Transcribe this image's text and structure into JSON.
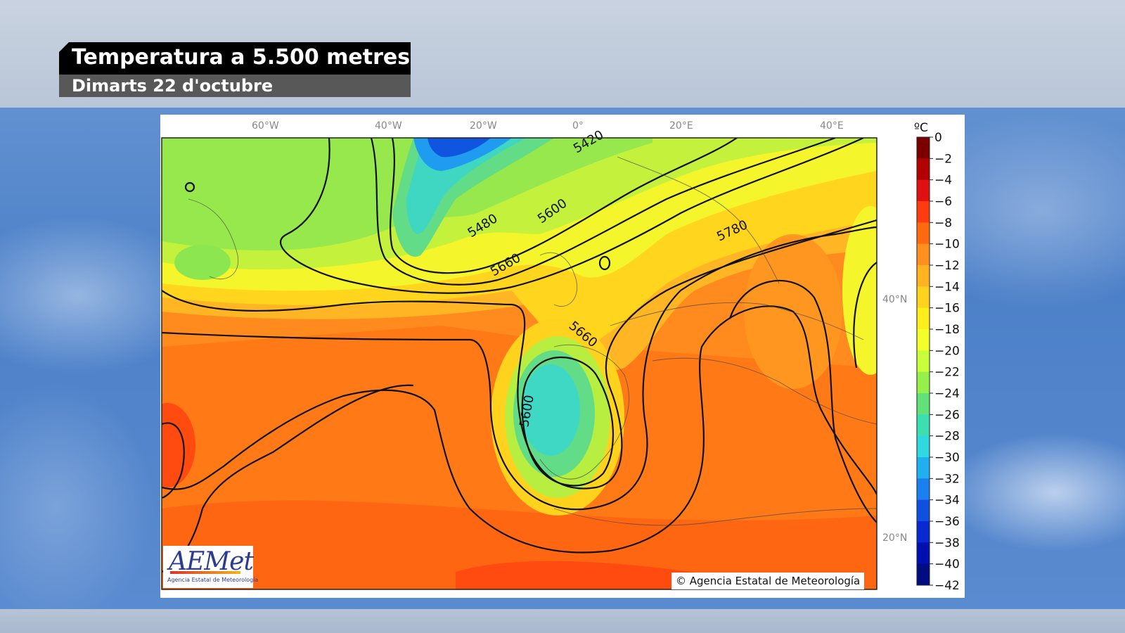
{
  "header": {
    "title": "Temperatura a 5.500 metres",
    "subtitle": "Dimarts 22 d'octubre"
  },
  "map": {
    "longitude_labels": [
      "60°W",
      "40°W",
      "20°W",
      "0°",
      "20°E",
      "40°E"
    ],
    "latitude_labels": [
      "40°N",
      "20°N"
    ],
    "contour_labels": [
      "5420",
      "5480",
      "5600",
      "5660",
      "5780",
      "5660",
      "5600"
    ],
    "copyright": "© Agencia Estatal de Meteorología"
  },
  "colorbar": {
    "unit": "ºC",
    "ticks": [
      "0",
      "−2",
      "−4",
      "−6",
      "−8",
      "−10",
      "−12",
      "−14",
      "−16",
      "−18",
      "−20",
      "−22",
      "−24",
      "−26",
      "−28",
      "−30",
      "−32",
      "−34",
      "−36",
      "−38",
      "−40",
      "−42"
    ],
    "colors": [
      "#7a0000",
      "#b30000",
      "#e01010",
      "#ff3c10",
      "#ff6a10",
      "#ff9020",
      "#ffb320",
      "#ffd21e",
      "#ffee1c",
      "#f2ff2a",
      "#c8ff3a",
      "#96f04a",
      "#62e07a",
      "#3ce0b0",
      "#30d8e0",
      "#20b0f0",
      "#1a80f0",
      "#1050e0",
      "#0828d0",
      "#0010b0",
      "#000c80"
    ]
  },
  "logo": {
    "name": "AEMet",
    "tagline": "Agencia Estatal de Meteorología"
  }
}
